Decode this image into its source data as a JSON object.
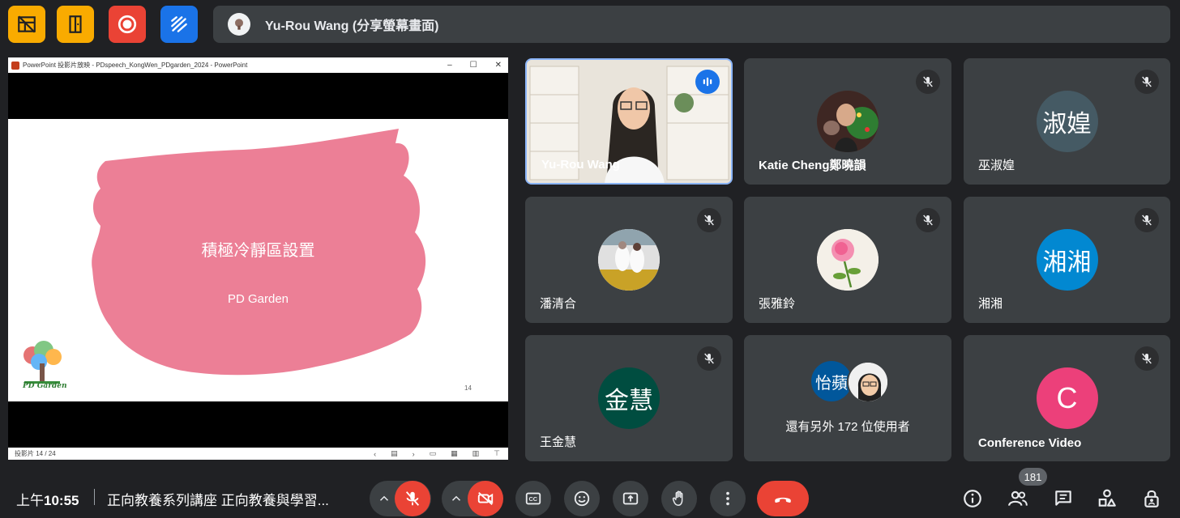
{
  "top_bar": {
    "buttons": [
      {
        "name": "layout-icon",
        "color": "#f9ab00"
      },
      {
        "name": "exit-door-icon",
        "color": "#f9ab00"
      },
      {
        "name": "record-icon",
        "color": "#ea4335"
      },
      {
        "name": "whiteboard-icon",
        "color": "#1a73e8"
      }
    ],
    "share_banner": "Yu-Rou Wang (分享螢幕畫面)"
  },
  "presentation": {
    "window_title": "PowerPoint 投影片放映 - PDspeech_KongWen_PDgarden_2024 - PowerPoint",
    "window_controls": [
      "–",
      "☐",
      "✕"
    ],
    "slide_title": "積極冷靜區設置",
    "slide_subtitle": "PD Garden",
    "logo_text": "PD Garden",
    "slide_number": "14",
    "status_left": "投影片 14 / 24",
    "brush_color": "#ec7f96"
  },
  "participants": [
    {
      "name": "Yu-Rou Wang",
      "speaking": true
    },
    {
      "name": "Katie Cheng鄭曉韻",
      "muted": true
    },
    {
      "name": "巫淑媓",
      "initials": "淑媓",
      "avatar_color": "#455a64",
      "muted": true
    },
    {
      "name": "潘清合",
      "muted": true
    },
    {
      "name": "張雅鈴",
      "muted": true
    },
    {
      "name": "湘湘",
      "initials": "湘湘",
      "avatar_color": "#0288d1",
      "muted": true
    },
    {
      "name": "王金慧",
      "initials": "金慧",
      "avatar_color": "#004d40",
      "muted": true
    },
    {
      "name": "others",
      "initials": "怡蘋",
      "avatar_color": "#01579b",
      "label": "還有另外 172 位使用者"
    },
    {
      "name": "Conference Video",
      "initials": "C",
      "avatar_color": "#ec407a",
      "muted": true
    }
  ],
  "bottom_bar": {
    "time_prefix": "上午",
    "time": "10:55",
    "meeting_title": "正向教養系列講座 正向教養與學習...",
    "participant_count": "181"
  }
}
